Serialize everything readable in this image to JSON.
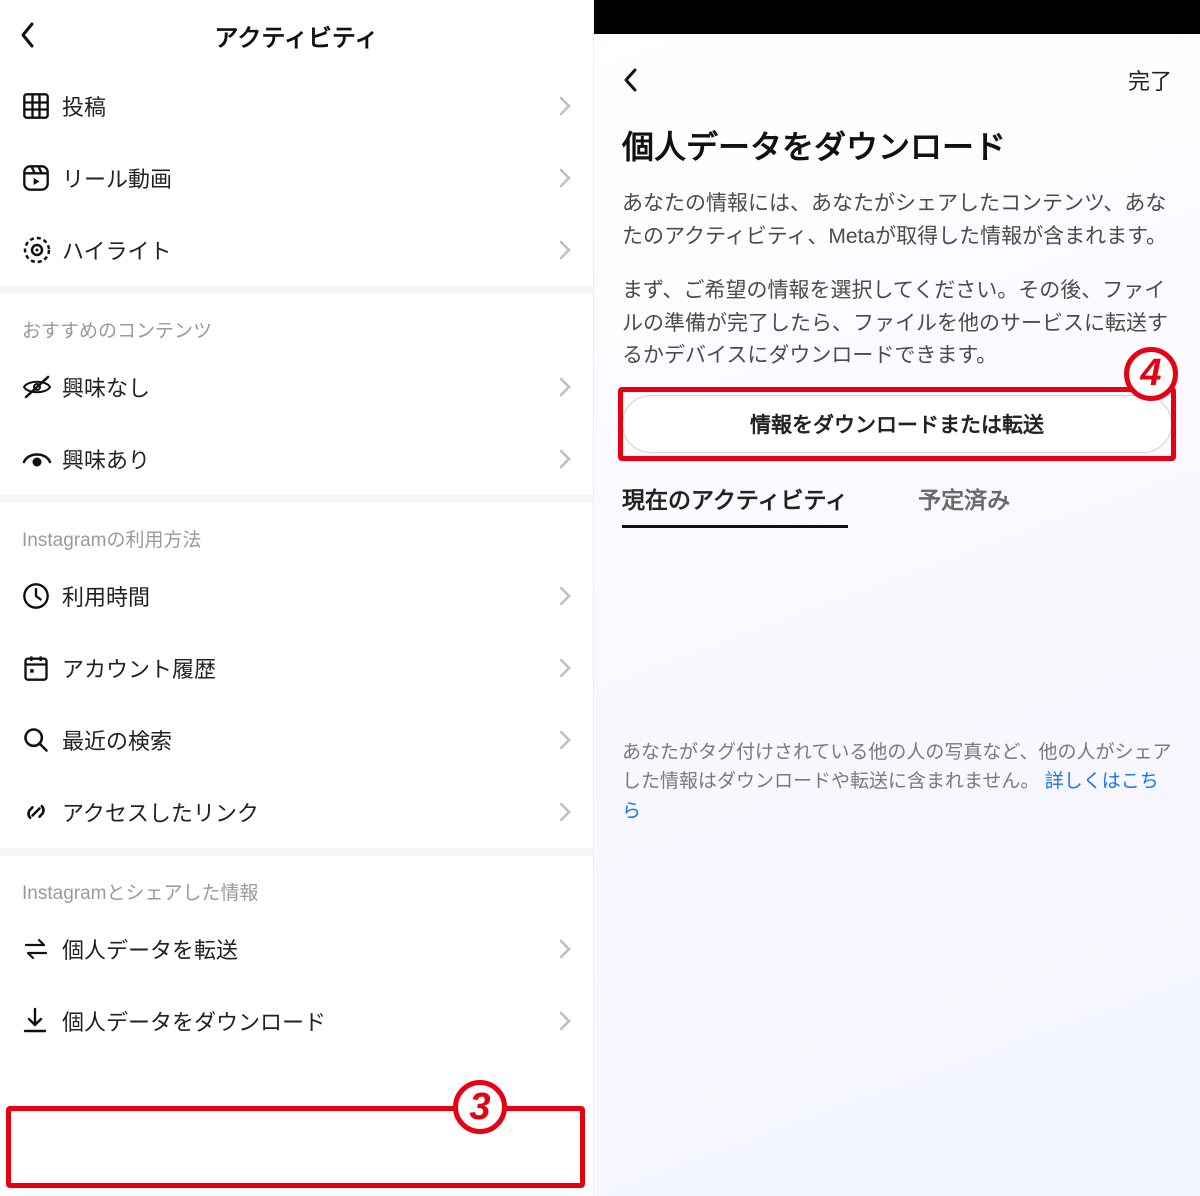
{
  "left": {
    "title": "アクティビティ",
    "items_top": [
      {
        "icon": "grid-icon",
        "label": "投稿"
      },
      {
        "icon": "reels-icon",
        "label": "リール動画"
      },
      {
        "icon": "highlight-icon",
        "label": "ハイライト"
      }
    ],
    "section_recommend": "おすすめのコンテンツ",
    "items_rec": [
      {
        "icon": "eye-off-icon",
        "label": "興味なし"
      },
      {
        "icon": "eye-on-icon",
        "label": "興味あり"
      }
    ],
    "section_usage": "Instagramの利用方法",
    "items_usage": [
      {
        "icon": "clock-icon",
        "label": "利用時間"
      },
      {
        "icon": "calendar-icon",
        "label": "アカウント履歴"
      },
      {
        "icon": "search-icon",
        "label": "最近の検索"
      },
      {
        "icon": "link-icon",
        "label": "アクセスしたリンク"
      }
    ],
    "section_share": "Instagramとシェアした情報",
    "items_share": [
      {
        "icon": "transfer-icon",
        "label": "個人データを転送"
      },
      {
        "icon": "download-icon",
        "label": "個人データをダウンロード"
      }
    ]
  },
  "right": {
    "done": "完了",
    "title": "個人データをダウンロード",
    "para1": "あなたの情報には、あなたがシェアしたコンテンツ、あなたのアクティビティ、Metaが取得した情報が含まれます。",
    "para2": "まず、ご希望の情報を選択してください。その後、ファイルの準備が完了したら、ファイルを他のサービスに転送するかデバイスにダウンロードできます。",
    "button": "情報をダウンロードまたは転送",
    "tab_active": "現在のアクティビティ",
    "tab_other": "予定済み",
    "note_text": "あなたがタグ付けされている他の人の写真など、他の人がシェアした情報はダウンロードや転送に含まれません。",
    "note_link": "詳しくはこちら"
  },
  "annotations": {
    "badge3": "3",
    "badge4": "4"
  }
}
